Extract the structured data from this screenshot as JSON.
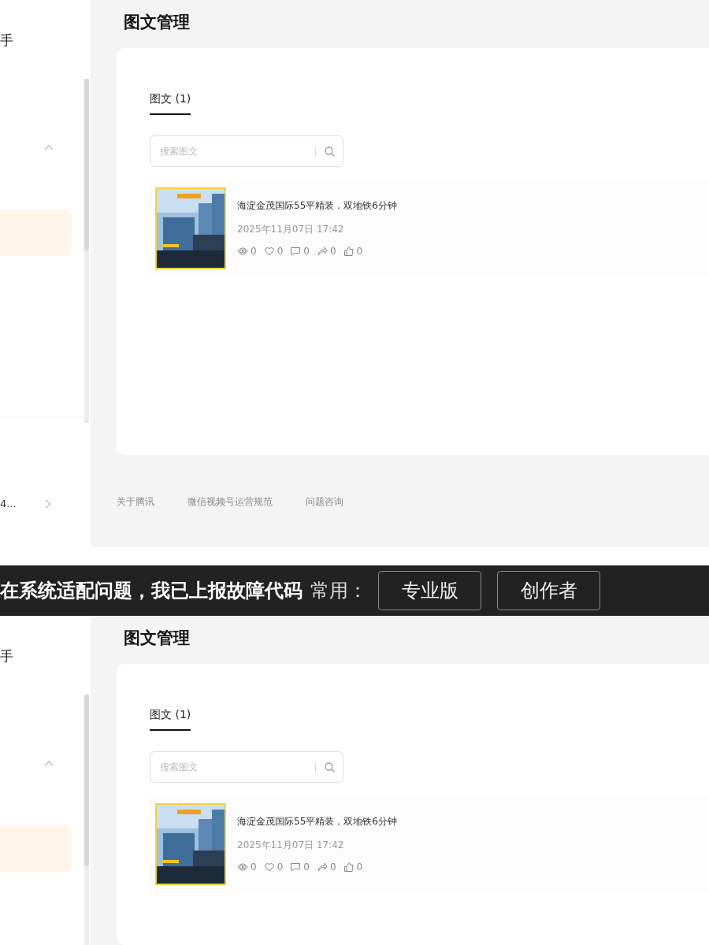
{
  "panels": [
    {
      "sidebar": {
        "title": "手",
        "group": {
          "expanded": true
        },
        "items": [
          {
            "selected": true
          }
        ],
        "bottom_item": {
          "label": "4..."
        }
      },
      "main": {
        "title": "图文管理",
        "tabs": [
          {
            "label": "图文 (1)",
            "selected": true
          }
        ],
        "search": {
          "placeholder": "搜索图文"
        },
        "posts": [
          {
            "kind": "picture",
            "title": "海淀金茂国际55平精装，双地铁6分钟",
            "date": "2025年11月07日 17:42",
            "stats": [
              {
                "kind": "views",
                "value": "0"
              },
              {
                "kind": "likes",
                "value": "0"
              },
              {
                "kind": "comments",
                "value": "0"
              },
              {
                "kind": "shares",
                "value": "0"
              },
              {
                "kind": "thumbs",
                "value": "0"
              }
            ]
          }
        ],
        "footer_links": [
          "关于腾讯",
          "微信视频号运营规范",
          "问题咨询"
        ]
      }
    },
    {
      "sidebar": {
        "title": "手",
        "group": {
          "expanded": true
        },
        "items": [
          {
            "selected": true
          }
        ]
      },
      "main": {
        "title": "图文管理",
        "tabs": [
          {
            "label": "图文 (1)",
            "selected": true
          }
        ],
        "search": {
          "placeholder": "搜索图文"
        },
        "posts": [
          {
            "kind": "picture",
            "title": "海淀金茂国际55平精装，双地铁6分钟",
            "date": "2025年11月07日 17:42",
            "stats": [
              {
                "kind": "views",
                "value": "0"
              },
              {
                "kind": "likes",
                "value": "0"
              },
              {
                "kind": "comments",
                "value": "0"
              },
              {
                "kind": "shares",
                "value": "0"
              },
              {
                "kind": "thumbs",
                "value": "0"
              }
            ]
          }
        ]
      }
    }
  ],
  "banner": {
    "text": "在系统适配问题，我已上报故障代码",
    "label": "常用：",
    "buttons": [
      "专业版",
      "创作者"
    ]
  }
}
